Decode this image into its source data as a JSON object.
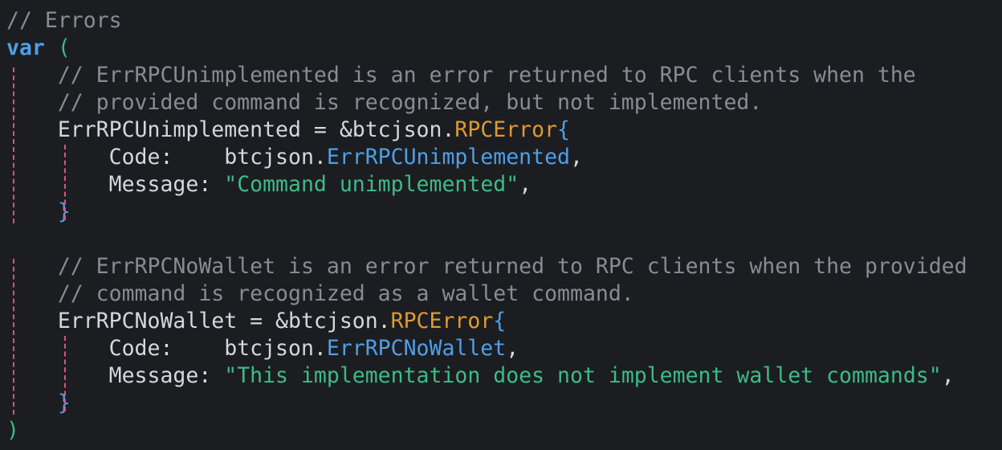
{
  "code": {
    "lines": [
      {
        "id": "l1",
        "parts": [
          {
            "t": "// Errors",
            "c": "comment"
          }
        ]
      },
      {
        "id": "l2",
        "parts": [
          {
            "t": "var",
            "c": "kw"
          },
          {
            "t": " ",
            "c": ""
          },
          {
            "t": "(",
            "c": "paren"
          }
        ]
      },
      {
        "id": "l3",
        "parts": [
          {
            "t": "    // ErrRPCUnimplemented is an error returned to RPC clients when the",
            "c": "comment"
          }
        ]
      },
      {
        "id": "l4",
        "parts": [
          {
            "t": "    // provided command is recognized, but not implemented.",
            "c": "comment"
          }
        ]
      },
      {
        "id": "l5",
        "parts": [
          {
            "t": "    ErrRPCUnimplemented = &btcjson.",
            "c": ""
          },
          {
            "t": "RPCError",
            "c": "type"
          },
          {
            "t": "{",
            "c": "brace"
          }
        ]
      },
      {
        "id": "l6",
        "parts": [
          {
            "t": "        Code:    btcjson.",
            "c": ""
          },
          {
            "t": "ErrRPCUnimplemented",
            "c": "field"
          },
          {
            "t": ",",
            "c": ""
          }
        ]
      },
      {
        "id": "l7",
        "parts": [
          {
            "t": "        Message: ",
            "c": ""
          },
          {
            "t": "\"Command unimplemented\"",
            "c": "str"
          },
          {
            "t": ",",
            "c": ""
          }
        ]
      },
      {
        "id": "l8",
        "parts": [
          {
            "t": "    ",
            "c": ""
          },
          {
            "t": "}",
            "c": "brace"
          }
        ]
      },
      {
        "id": "l9",
        "parts": [
          {
            "t": "",
            "c": ""
          }
        ]
      },
      {
        "id": "l10",
        "parts": [
          {
            "t": "    // ErrRPCNoWallet is an error returned to RPC clients when the provided",
            "c": "comment"
          }
        ]
      },
      {
        "id": "l11",
        "parts": [
          {
            "t": "    // command is recognized as a wallet command.",
            "c": "comment"
          }
        ]
      },
      {
        "id": "l12",
        "parts": [
          {
            "t": "    ErrRPCNoWallet = &btcjson.",
            "c": ""
          },
          {
            "t": "RPCError",
            "c": "type"
          },
          {
            "t": "{",
            "c": "brace"
          }
        ]
      },
      {
        "id": "l13",
        "parts": [
          {
            "t": "        Code:    btcjson.",
            "c": ""
          },
          {
            "t": "ErrRPCNoWallet",
            "c": "field"
          },
          {
            "t": ",",
            "c": ""
          }
        ]
      },
      {
        "id": "l14",
        "parts": [
          {
            "t": "        Message: ",
            "c": ""
          },
          {
            "t": "\"This implementation does not implement wallet commands\"",
            "c": "str"
          },
          {
            "t": ",",
            "c": ""
          }
        ]
      },
      {
        "id": "l15",
        "parts": [
          {
            "t": "    ",
            "c": ""
          },
          {
            "t": "}",
            "c": "brace"
          }
        ]
      },
      {
        "id": "l16",
        "parts": [
          {
            "t": ")",
            "c": "paren"
          }
        ]
      }
    ]
  },
  "colors": {
    "background": "#1c1d21",
    "text": "#d6d6dc",
    "comment": "#8a8b93",
    "keyword": "#4f9fe6",
    "type": "#dd9b33",
    "string": "#3dbb86",
    "indent_guide": "#e0507a"
  }
}
